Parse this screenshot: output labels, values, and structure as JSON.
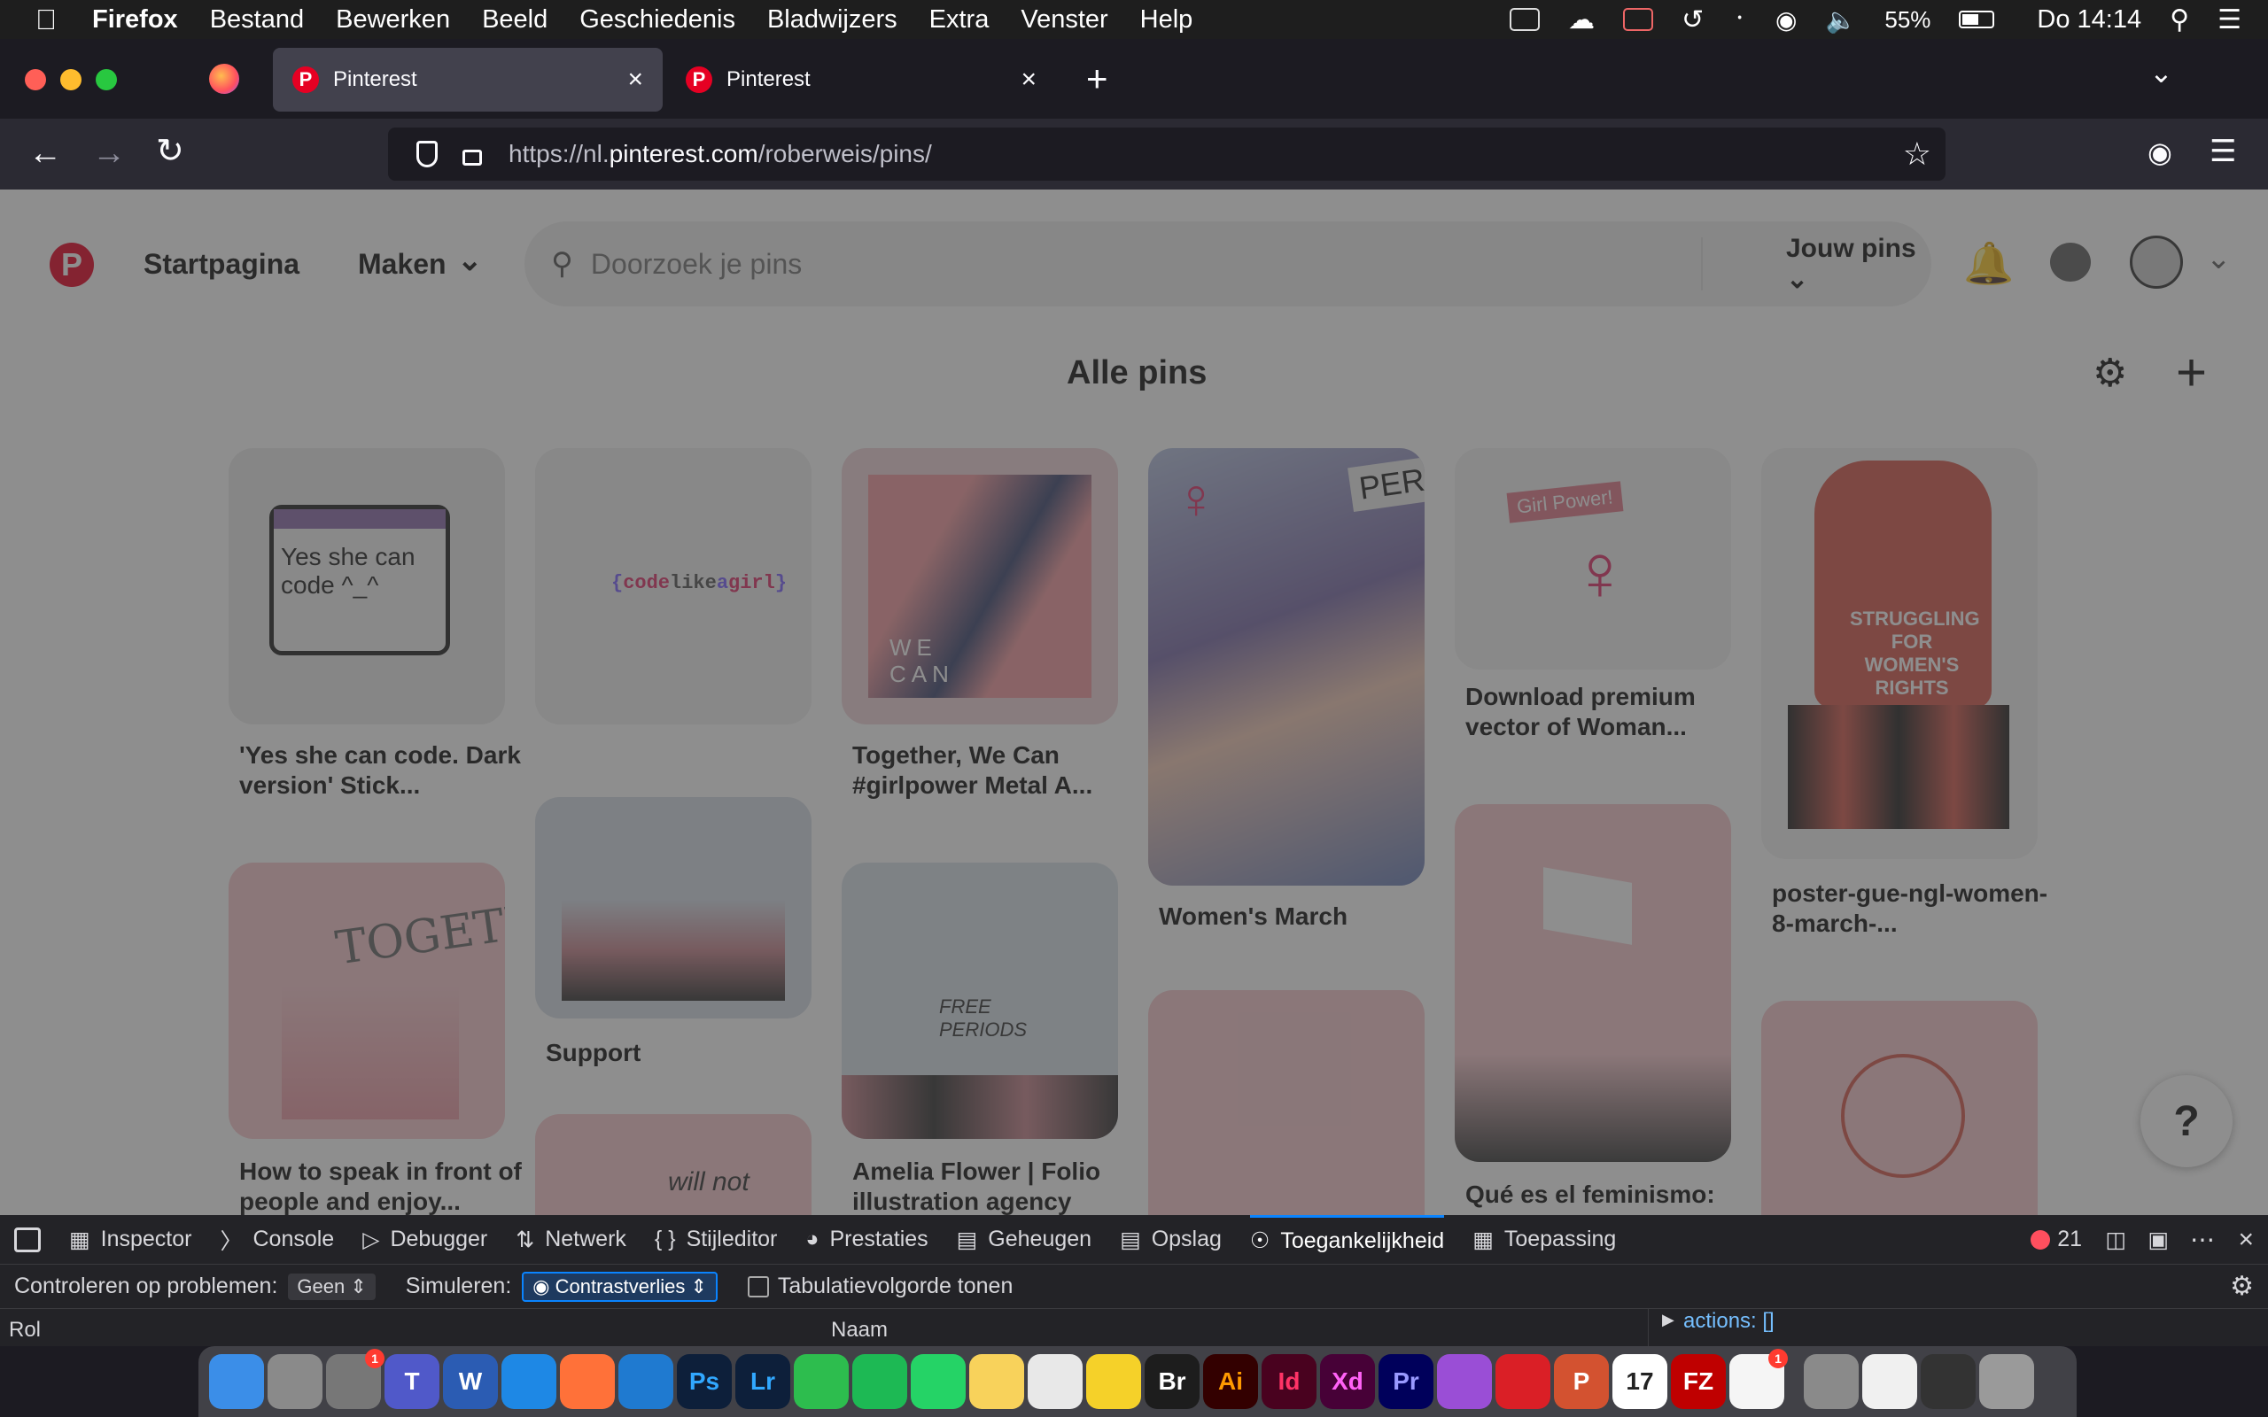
{
  "menubar": {
    "app": "Firefox",
    "items": [
      "Bestand",
      "Bewerken",
      "Beeld",
      "Geschiedenis",
      "Bladwijzers",
      "Extra",
      "Venster",
      "Help"
    ],
    "battery": "55%",
    "clock": "Do 14:14"
  },
  "tabs": [
    {
      "title": "Pinterest"
    },
    {
      "title": "Pinterest"
    }
  ],
  "url": {
    "prefix": "https://nl.",
    "domain": "pinterest.com",
    "path": "/roberweis/pins/"
  },
  "pinterest": {
    "nav_home": "Startpagina",
    "nav_create": "Maken",
    "search_placeholder": "Doorzoek je pins",
    "scope": "Jouw pins",
    "heading": "Alle pins",
    "help": "?"
  },
  "pins": [
    {
      "caption": "'Yes she can code. Dark version' Stick...",
      "art_text": "Yes she can code ^_^"
    },
    {
      "caption": "",
      "art_text_1": "{",
      "art_text_2": "code",
      "art_text_3": "like",
      "art_text_4": "a",
      "art_text_5": "girl",
      "art_text_6": "}"
    },
    {
      "caption": "Together, We Can #girlpower Metal A...",
      "art_text": "WE CAN"
    },
    {
      "caption": "Women's March",
      "art_text": "PERS"
    },
    {
      "caption": "Download premium vector of Woman...",
      "art_text": "Girl Power!"
    },
    {
      "caption": "poster-gue-ngl-women-8-march-...",
      "art_text": "STRUGGLING FOR WOMEN'S RIGHTS"
    },
    {
      "caption": "Support"
    },
    {
      "caption": "How to speak in front of people and enjoy...",
      "art_text": "TOGETHER"
    },
    {
      "caption": "Amelia Flower | Folio illustration agency",
      "art_text": "FREE PERIODS"
    },
    {
      "caption": "Qué es el feminismo:"
    },
    {
      "caption": ""
    },
    {
      "caption": ""
    },
    {
      "caption": "",
      "art_text": "will not"
    }
  ],
  "devtools": {
    "tabs": [
      "Inspector",
      "Console",
      "Debugger",
      "Netwerk",
      "Stijleditor",
      "Prestaties",
      "Geheugen",
      "Opslag",
      "Toegankelijkheid",
      "Toepassing"
    ],
    "error_count": "21",
    "check_label": "Controleren op problemen:",
    "check_value": "Geen",
    "simulate_label": "Simuleren:",
    "simulate_value": "Contrastverlies",
    "tab_order": "Tabulatievolgorde tonen",
    "col_role": "Rol",
    "col_name": "Naam",
    "actions": "actions: []"
  },
  "dock": [
    {
      "icon": "finder-icon",
      "label": ""
    },
    {
      "icon": "launchpad-icon",
      "label": ""
    },
    {
      "icon": "system-preferences-icon",
      "label": "",
      "badge": "1"
    },
    {
      "icon": "teams-icon",
      "label": "T"
    },
    {
      "icon": "word-icon",
      "label": "W"
    },
    {
      "icon": "safari-icon",
      "label": ""
    },
    {
      "icon": "firefox-icon",
      "label": ""
    },
    {
      "icon": "vscode-icon",
      "label": ""
    },
    {
      "icon": "photoshop-icon",
      "label": "Ps"
    },
    {
      "icon": "lightroom-icon",
      "label": "Lr"
    },
    {
      "icon": "facetime-icon",
      "label": ""
    },
    {
      "icon": "spotify-icon",
      "label": ""
    },
    {
      "icon": "whatsapp-icon",
      "label": ""
    },
    {
      "icon": "notes-icon",
      "label": ""
    },
    {
      "icon": "chrome-icon",
      "label": ""
    },
    {
      "icon": "miro-icon",
      "label": ""
    },
    {
      "icon": "bridge-icon",
      "label": "Br"
    },
    {
      "icon": "illustrator-icon",
      "label": "Ai"
    },
    {
      "icon": "indesign-icon",
      "label": "Id"
    },
    {
      "icon": "xd-icon",
      "label": "Xd"
    },
    {
      "icon": "premiere-icon",
      "label": "Pr"
    },
    {
      "icon": "podcasts-icon",
      "label": ""
    },
    {
      "icon": "creative-cloud-icon",
      "label": ""
    },
    {
      "icon": "powerpoint-icon",
      "label": "P"
    },
    {
      "icon": "calendar-icon",
      "label": "17"
    },
    {
      "icon": "filezilla-icon",
      "label": "FZ"
    },
    {
      "icon": "reminders-icon",
      "label": "",
      "badge": "1"
    },
    {
      "icon": "accessibility-icon",
      "label": ""
    },
    {
      "icon": "document-icon",
      "label": ""
    },
    {
      "icon": "screenshot-icon",
      "label": ""
    },
    {
      "icon": "trash-icon",
      "label": ""
    }
  ],
  "colors": {
    "pinterest_red": "#e60023",
    "firefox_tab": "#42414d",
    "devtools_accent": "#0a84ff"
  }
}
